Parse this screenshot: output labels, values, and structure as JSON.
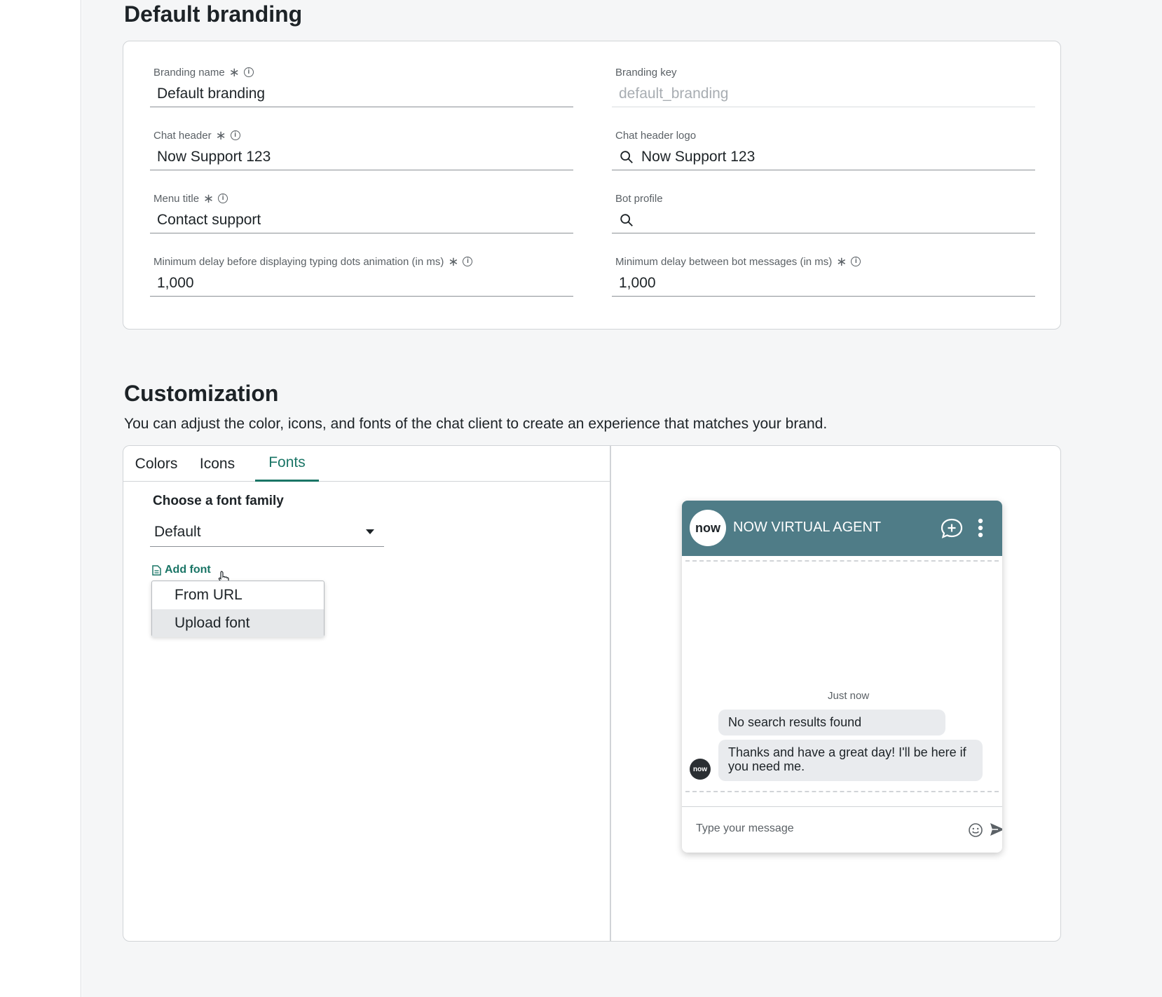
{
  "branding": {
    "title": "Default branding",
    "fields": {
      "branding_name": {
        "label": "Branding name",
        "value": "Default branding"
      },
      "branding_key": {
        "label": "Branding key",
        "value": "default_branding"
      },
      "chat_header": {
        "label": "Chat header",
        "value": "Now Support 123"
      },
      "chat_header_logo": {
        "label": "Chat header logo",
        "value": "Now Support 123"
      },
      "menu_title": {
        "label": "Menu title",
        "value": "Contact support"
      },
      "bot_profile": {
        "label": "Bot profile",
        "value": ""
      },
      "min_delay_typing": {
        "label": "Minimum delay before displaying typing dots animation (in ms)",
        "value": "1,000"
      },
      "min_delay_bot": {
        "label": "Minimum delay between bot messages (in ms)",
        "value": "1,000"
      }
    },
    "required_mark": "∗",
    "info_mark": "i"
  },
  "customization": {
    "title": "Customization",
    "subtitle": "You can adjust the color, icons, and fonts of the chat client to create an experience that matches your brand.",
    "tabs": [
      {
        "label": "Colors",
        "active": false
      },
      {
        "label": "Icons",
        "active": false
      },
      {
        "label": "Fonts",
        "active": true
      }
    ],
    "font_family_label": "Choose a font family",
    "font_family_value": "Default",
    "add_font_label": "Add font",
    "add_font_options": [
      "From URL",
      "Upload font"
    ],
    "highlighted_option": "Upload font"
  },
  "preview": {
    "header_title": "NOW VIRTUAL AGENT",
    "logo_text": "now",
    "timestamp": "Just now",
    "messages": [
      "No search results found",
      "Thanks and have a great day! I'll be here if you need me."
    ],
    "input_placeholder": "Type your message"
  },
  "colors": {
    "accent": "#1a7566",
    "chat_header": "#4f7c87",
    "page_bg": "#f5f6f7"
  }
}
